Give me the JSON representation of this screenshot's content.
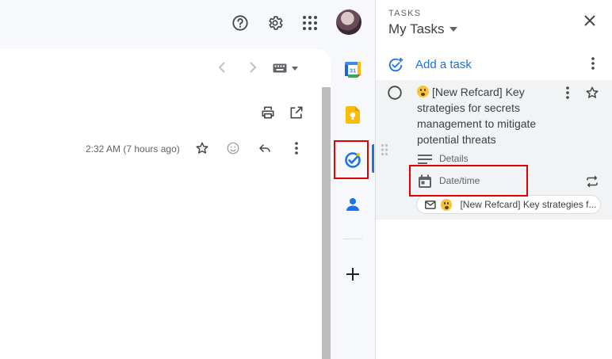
{
  "header": {
    "help_icon": "help-circle",
    "settings_icon": "gear",
    "apps_icon": "grid",
    "avatar": "account-avatar"
  },
  "mail": {
    "timestamp": "2:32 AM (7 hours ago)"
  },
  "rail": {
    "items": [
      "calendar",
      "keep",
      "tasks",
      "contacts",
      "add"
    ],
    "calendar_day": "31",
    "active": "tasks"
  },
  "tasks": {
    "section_label": "TASKS",
    "list_name": "My Tasks",
    "add_task_label": "Add a task",
    "task": {
      "title": "[New Refcard] Key strategies for secrets management to mitigate potential threats",
      "details_placeholder": "Details",
      "datetime_placeholder": "Date/time",
      "linked_email": "[New Refcard] Key strategies f..."
    }
  },
  "colors": {
    "accent": "#1a73e8",
    "highlight": "#e00000",
    "card_bg": "#f1f3f4"
  }
}
